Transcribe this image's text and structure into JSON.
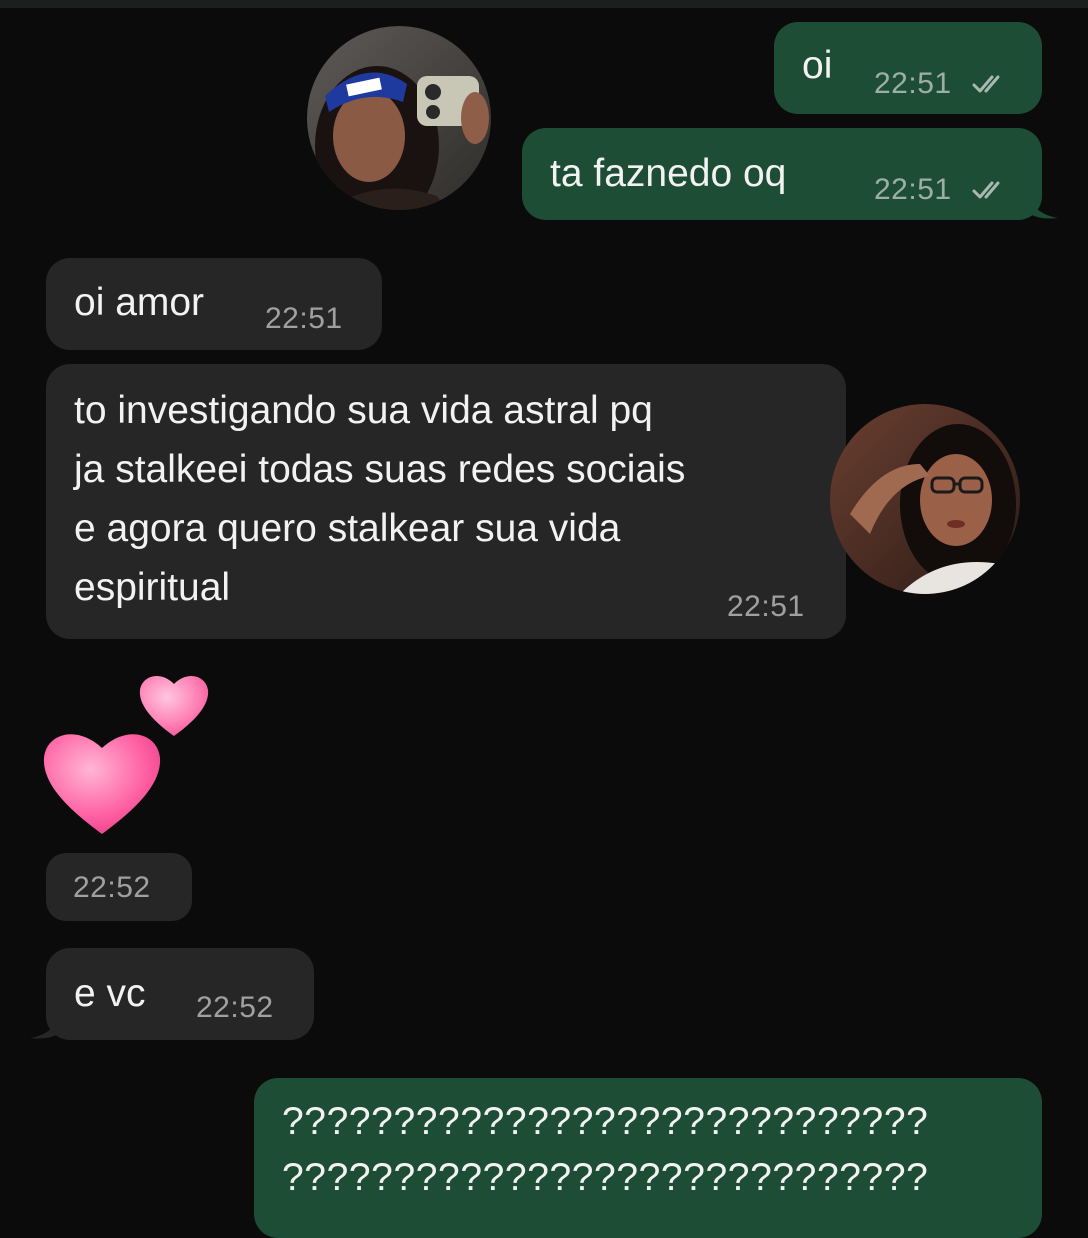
{
  "messages": [
    {
      "id": "m1",
      "direction": "out",
      "text": "oi",
      "time": "22:51",
      "status": "read"
    },
    {
      "id": "m2",
      "direction": "out",
      "text": "ta faznedo oq",
      "time": "22:51",
      "status": "read"
    },
    {
      "id": "m3",
      "direction": "in",
      "text": "oi amor",
      "time": "22:51"
    },
    {
      "id": "m4",
      "direction": "in",
      "lines": [
        "to investigando sua vida astral pq",
        "ja stalkeei todas suas redes sociais",
        "e agora quero stalkear sua vida",
        "espiritual"
      ],
      "time": "22:51"
    },
    {
      "id": "m5",
      "direction": "in",
      "emoji": "two-hearts",
      "time": "22:52"
    },
    {
      "id": "m6",
      "direction": "in",
      "text": "e vc",
      "time": "22:52"
    },
    {
      "id": "m7",
      "direction": "out",
      "lines": [
        "?????????????????????????????",
        "?????????????????????????????"
      ]
    }
  ],
  "colors": {
    "background": "#0b0b0b",
    "outgoing_bubble": "#1d4d34",
    "incoming_bubble": "#262626",
    "heart_pink": "#ff5fa2"
  },
  "icons": {
    "read_receipt": "double-check-icon",
    "avatar_1": "avatar-photo",
    "avatar_2": "avatar-photo"
  }
}
